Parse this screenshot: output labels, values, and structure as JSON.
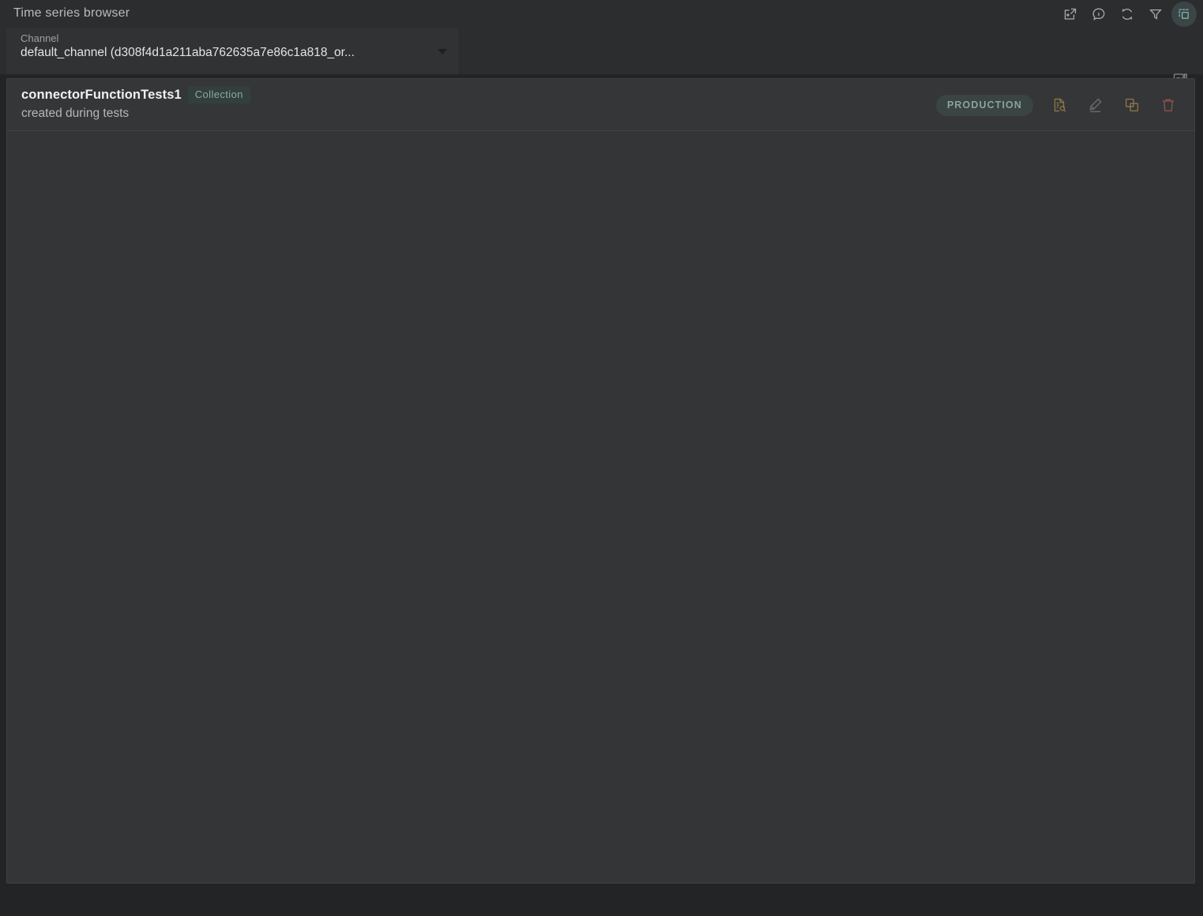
{
  "titlebar": {
    "title": "Time series browser",
    "actions": [
      {
        "name": "open-in-new-window-icon",
        "label": "Open in new window"
      },
      {
        "name": "info-icon",
        "label": "Info"
      },
      {
        "name": "refresh-icon",
        "label": "Refresh"
      },
      {
        "name": "filter-icon",
        "label": "Filter"
      },
      {
        "name": "select-copy-icon",
        "label": "Select",
        "active": true
      }
    ]
  },
  "channel": {
    "label": "Channel",
    "value": "default_channel (d308f4d1a211aba762635a7e86c1a818_or...",
    "caret": "chevron-down-icon",
    "fx_button": "fx-search-icon"
  },
  "collection": {
    "name": "connectorFunctionTests1",
    "type_chip": "Collection",
    "description": "created during tests",
    "environment_chip": "PRODUCTION",
    "actions": [
      {
        "name": "inspect-document-icon",
        "label": "Inspect",
        "color": "#8a7446"
      },
      {
        "name": "edit-pencil-icon",
        "label": "Edit",
        "color": "#6a6d6e"
      },
      {
        "name": "duplicate-icon",
        "label": "Duplicate",
        "color": "#8a7446"
      },
      {
        "name": "delete-trash-icon",
        "label": "Delete",
        "color": "#8a5149"
      }
    ]
  },
  "colors": {
    "background": "#222425",
    "header": "#2b2d2e",
    "panel": "#333536",
    "row": "#343638",
    "accent_teal": "#7fb3ad",
    "accent_amber": "#8a7446",
    "accent_red": "#8a5149"
  }
}
